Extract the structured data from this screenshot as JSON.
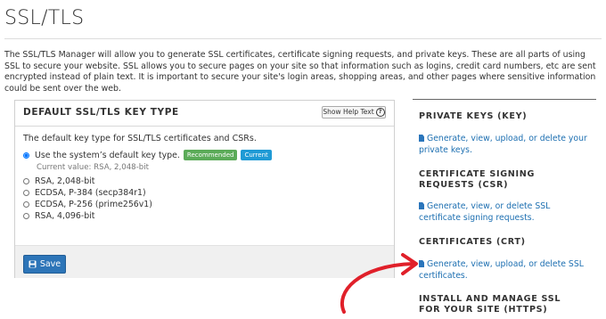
{
  "page": {
    "title": "SSL/TLS",
    "intro": "The SSL/TLS Manager will allow you to generate SSL certificates, certificate signing requests, and private keys. These are all parts of using SSL to secure your website. SSL allows you to secure pages on your site so that information such as logins, credit card numbers, etc are sent encrypted instead of plain text. It is important to secure your site's login areas, shopping areas, and other pages where sensitive information could be sent over the web."
  },
  "panel": {
    "title": "DEFAULT SSL/TLS KEY TYPE",
    "help_label": "Show Help Text",
    "description": "The default key type for SSL/TLS certificates and CSRs.",
    "default_option": {
      "label": "Use the system’s default key type.",
      "badge_recommended": "Recommended",
      "badge_current": "Current",
      "current_value": "Current value: RSA, 2,048-bit",
      "selected": true
    },
    "options": [
      {
        "label": "RSA, 2,048-bit",
        "selected": false
      },
      {
        "label": "ECDSA, P-384 (secp384r1)",
        "selected": false
      },
      {
        "label": "ECDSA, P-256 (prime256v1)",
        "selected": false
      },
      {
        "label": "RSA, 4,096-bit",
        "selected": false
      }
    ],
    "save_label": "Save"
  },
  "sidebar": {
    "sections": [
      {
        "heading": "PRIVATE KEYS (KEY)",
        "link": "Generate, view, upload, or delete your private keys."
      },
      {
        "heading": "CERTIFICATE SIGNING REQUESTS (CSR)",
        "link": "Generate, view, or delete SSL certificate signing requests."
      },
      {
        "heading": "CERTIFICATES (CRT)",
        "link": "Generate, view, upload, or delete SSL certificates."
      },
      {
        "heading": "INSTALL AND MANAGE SSL FOR YOUR SITE (HTTPS)",
        "link": ""
      }
    ]
  },
  "colors": {
    "link": "#1d6fb1",
    "save_button": "#2d75b8",
    "badge_recommended": "#5bab58",
    "badge_current": "#1f9ad5",
    "annotation_arrow": "#e0202a"
  },
  "icons": [
    "help-circle-icon",
    "save-disk-icon",
    "file-icon",
    "annotation-arrow-icon"
  ]
}
